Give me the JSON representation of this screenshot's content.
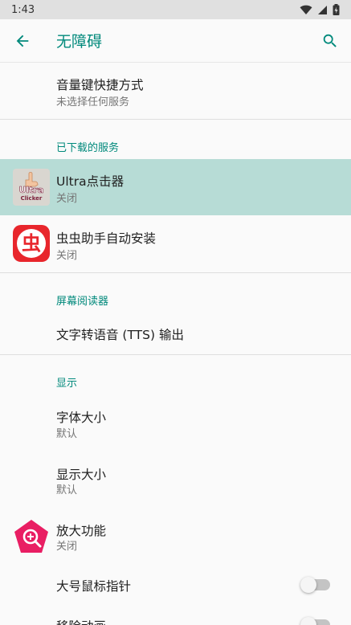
{
  "status_bar": {
    "time": "1:43"
  },
  "app_bar": {
    "title": "无障碍"
  },
  "volume_shortcut": {
    "title": "音量键快捷方式",
    "subtitle": "未选择任何服务"
  },
  "downloaded_services": {
    "header": "已下载的服务",
    "items": [
      {
        "title": "Ultra点击器",
        "subtitle": "关闭",
        "icon_text_top": "Ultra",
        "icon_text_bottom": "Clicker"
      },
      {
        "title": "虫虫助手自动安装",
        "subtitle": "关闭",
        "icon_glyph": "虫"
      }
    ]
  },
  "screen_readers": {
    "header": "屏幕阅读器",
    "tts": "文字转语音 (TTS) 输出"
  },
  "display": {
    "header": "显示",
    "font_size": {
      "title": "字体大小",
      "subtitle": "默认"
    },
    "display_size": {
      "title": "显示大小",
      "subtitle": "默认"
    },
    "magnification": {
      "title": "放大功能",
      "subtitle": "关闭"
    },
    "large_pointer": {
      "title": "大号鼠标指针"
    },
    "remove_animations": {
      "title": "移除动画"
    }
  },
  "colors": {
    "accent": "#00897b",
    "highlight": "#b7dcd6",
    "chongchong_red": "#e8262c",
    "magnify_pink": "#e91e63"
  }
}
